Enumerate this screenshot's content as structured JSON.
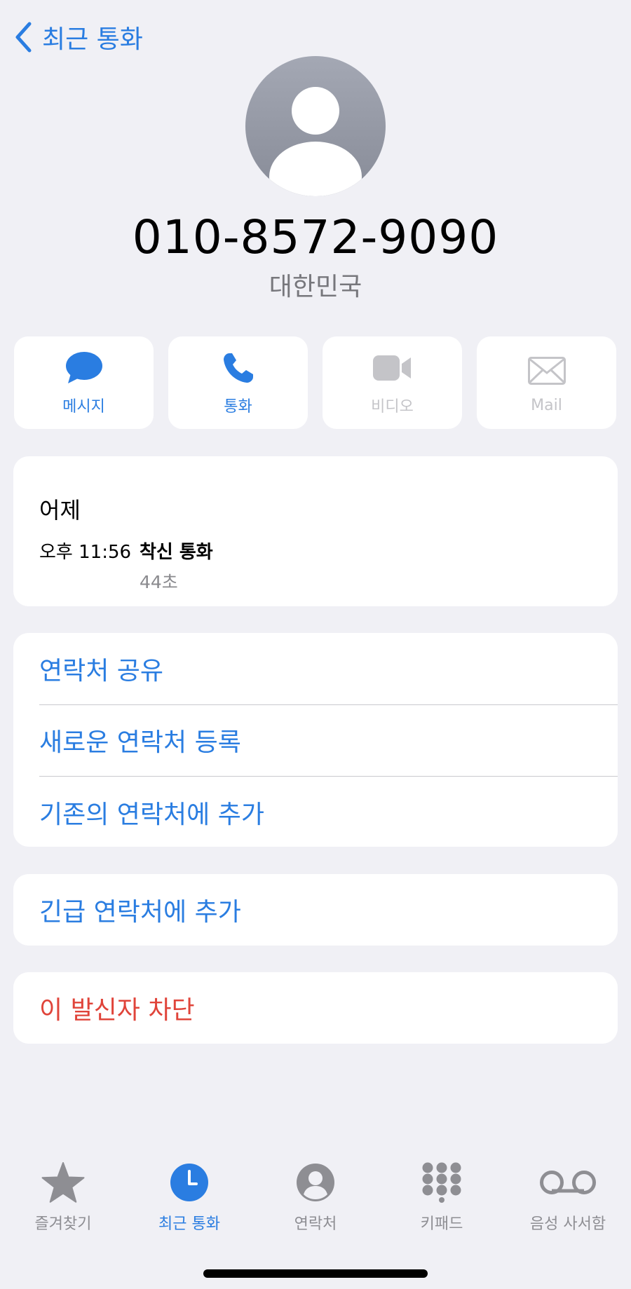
{
  "nav": {
    "back_label": "최근 통화"
  },
  "contact": {
    "number": "010-8572-9090",
    "country": "대한민국"
  },
  "actions": [
    {
      "label": "메시지",
      "icon": "message-icon",
      "enabled": true
    },
    {
      "label": "통화",
      "icon": "phone-icon",
      "enabled": true
    },
    {
      "label": "비디오",
      "icon": "video-icon",
      "enabled": false
    },
    {
      "label": "Mail",
      "icon": "mail-icon",
      "enabled": false
    }
  ],
  "recent": {
    "day": "어제",
    "time": "오후 11:56",
    "type": "착신 통화",
    "duration": "44초"
  },
  "options": [
    "연락처 공유",
    "새로운 연락처 등록",
    "기존의 연락처에 추가"
  ],
  "emergency": "긴급 연락처에 추가",
  "block": "이 발신자 차단",
  "tabs": [
    {
      "label": "즐겨찾기",
      "icon": "star-icon",
      "active": false
    },
    {
      "label": "최근 통화",
      "icon": "clock-icon",
      "active": true
    },
    {
      "label": "연락처",
      "icon": "person-circle-icon",
      "active": false
    },
    {
      "label": "키패드",
      "icon": "keypad-icon",
      "active": false
    },
    {
      "label": "음성 사서함",
      "icon": "voicemail-icon",
      "active": false
    }
  ],
  "colors": {
    "accent": "#2a7de1",
    "destructive": "#e0443a",
    "background": "#f0f0f5",
    "disabled": "#c4c4c8"
  }
}
